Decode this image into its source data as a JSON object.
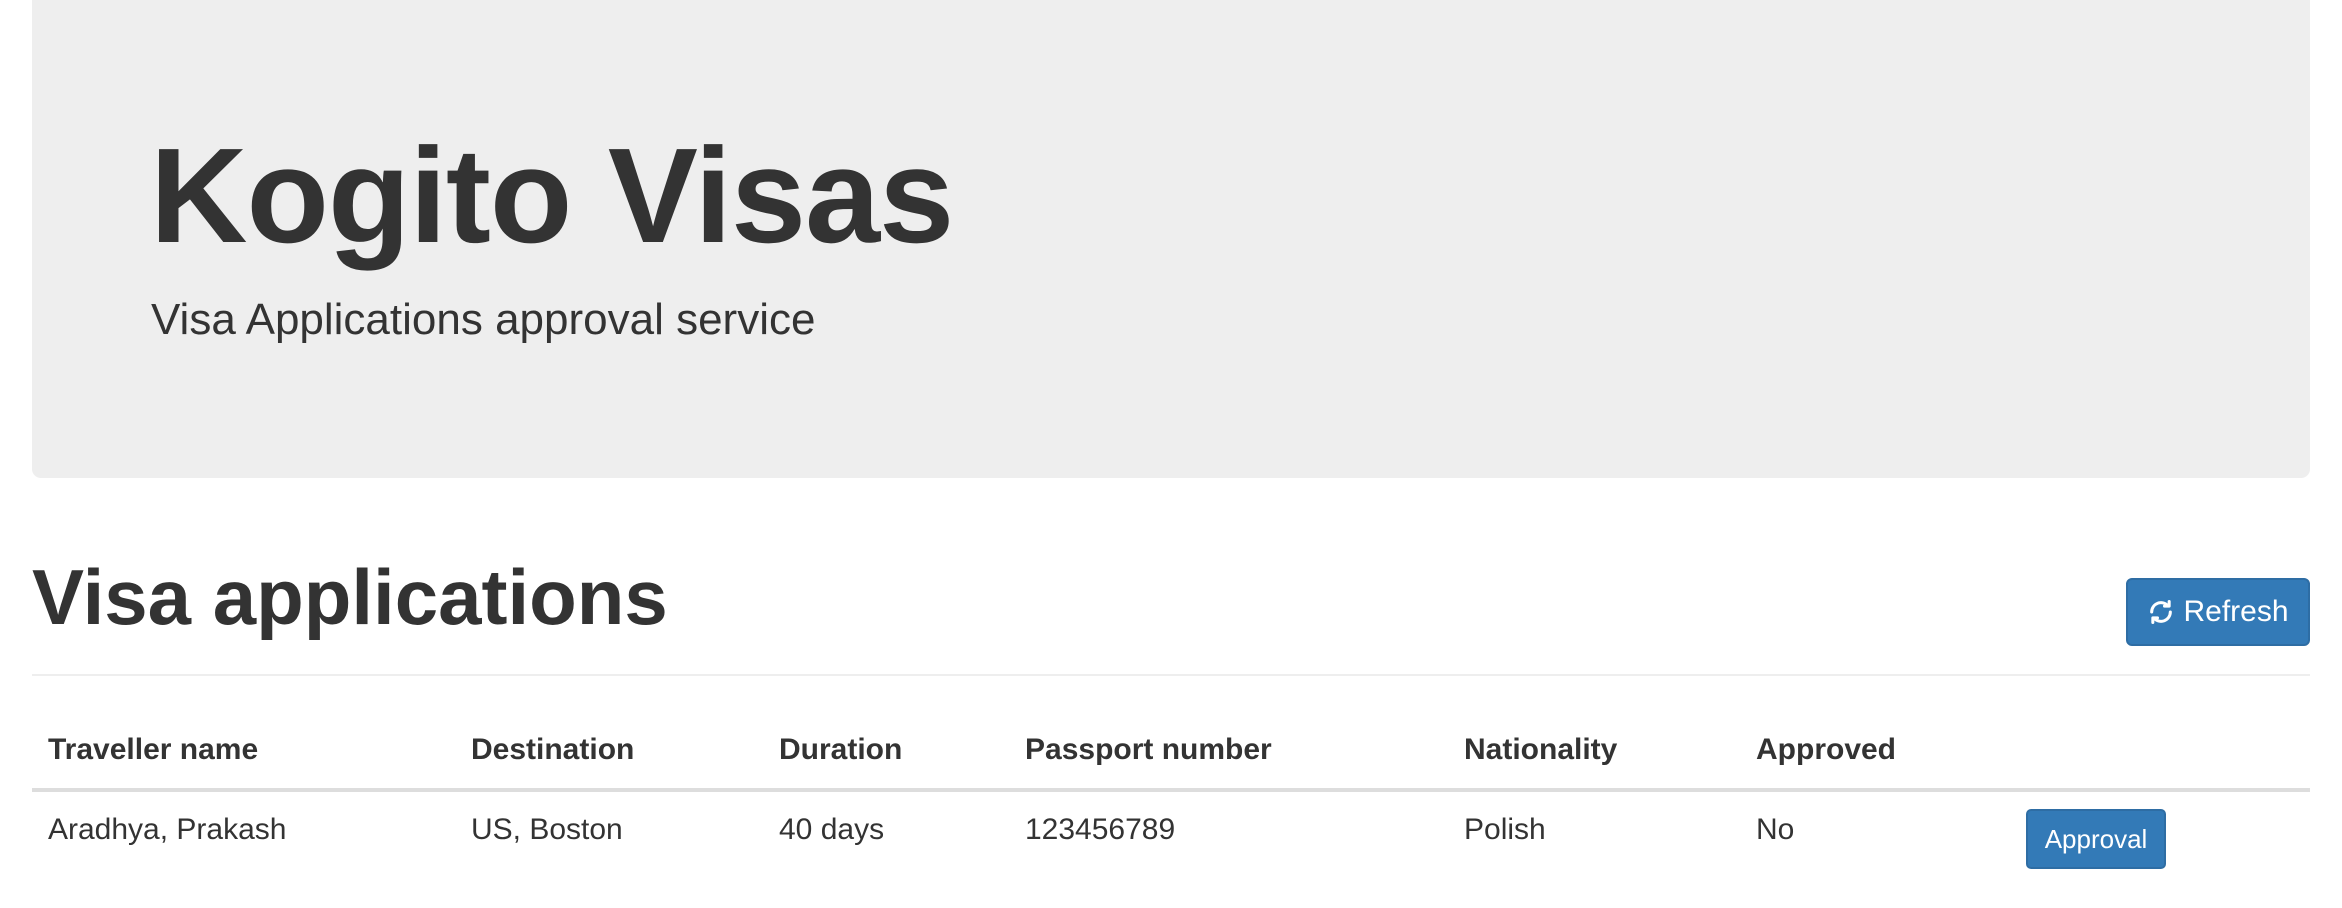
{
  "jumbotron": {
    "title": "Kogito Visas",
    "subtitle": "Visa Applications approval service"
  },
  "header": {
    "title": "Visa applications",
    "refresh_label": "Refresh",
    "refresh_icon": "refresh-icon"
  },
  "table": {
    "headers": [
      "Traveller name",
      "Destination",
      "Duration",
      "Passport number",
      "Nationality",
      "Approved",
      ""
    ],
    "rows": [
      {
        "traveller_name": "Aradhya, Prakash",
        "destination": "US, Boston",
        "duration": "40 days",
        "passport_number": "123456789",
        "nationality": "Polish",
        "approved": "No",
        "action_label": "Approval"
      }
    ]
  },
  "colors": {
    "primary": "#337ab7",
    "jumbotron_bg": "#eeeeee",
    "text": "#333333"
  }
}
